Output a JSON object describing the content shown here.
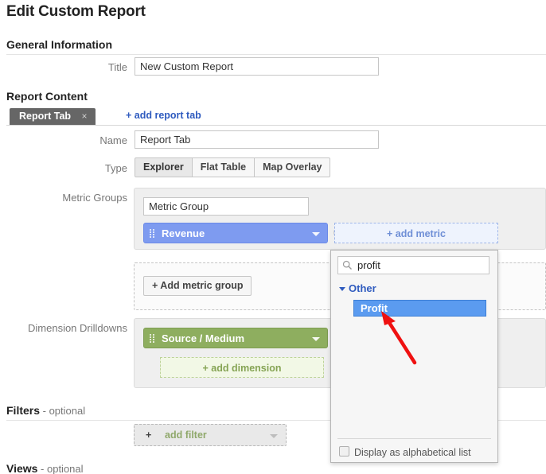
{
  "page": {
    "title": "Edit Custom Report"
  },
  "general": {
    "heading": "General Information",
    "title_label": "Title",
    "title_value": "New Custom Report",
    "title_placeholder": "Report title"
  },
  "report_content": {
    "heading": "Report Content",
    "tab": {
      "label": "Report Tab",
      "close_icon": "×"
    },
    "add_tab_label": "+ add report tab",
    "name_label": "Name",
    "name_value": "Report Tab",
    "name_placeholder": "Tab name",
    "type_label": "Type",
    "type_options": [
      {
        "label": "Explorer",
        "selected": true
      },
      {
        "label": "Flat Table",
        "selected": false
      },
      {
        "label": "Map Overlay",
        "selected": false
      }
    ],
    "metric_groups": {
      "label": "Metric Groups",
      "group_name_value": "Metric Group",
      "group_name_placeholder": "Metric group name",
      "metric_chip": "Revenue",
      "add_metric_label": "+ add metric",
      "add_metric_group_label": "+ Add metric group"
    },
    "dimension_drilldowns": {
      "label": "Dimension Drilldowns",
      "dimension_chip": "Source / Medium",
      "add_dimension_label": "+ add dimension"
    }
  },
  "filters": {
    "heading": "Filters",
    "optional": " - optional",
    "add_filter_plus": "+",
    "add_filter_text": "add filter"
  },
  "views": {
    "heading": "Views",
    "optional": " - optional"
  },
  "metric_dropdown": {
    "search_value": "profit",
    "search_placeholder": "",
    "search_icon": "search-icon",
    "group_label": "Other",
    "items": [
      {
        "label": "Profit",
        "selected": true
      }
    ],
    "alphabetical_label": "Display as alphabetical list",
    "alphabetical_checked": false
  },
  "colors": {
    "metric_chip": "#7e9bf0",
    "dimension_chip": "#8eae5f",
    "selected_item": "#5b9bf0",
    "link": "#2f5bbf",
    "tab_active": "#666666",
    "annotation_arrow": "#ef1111"
  }
}
